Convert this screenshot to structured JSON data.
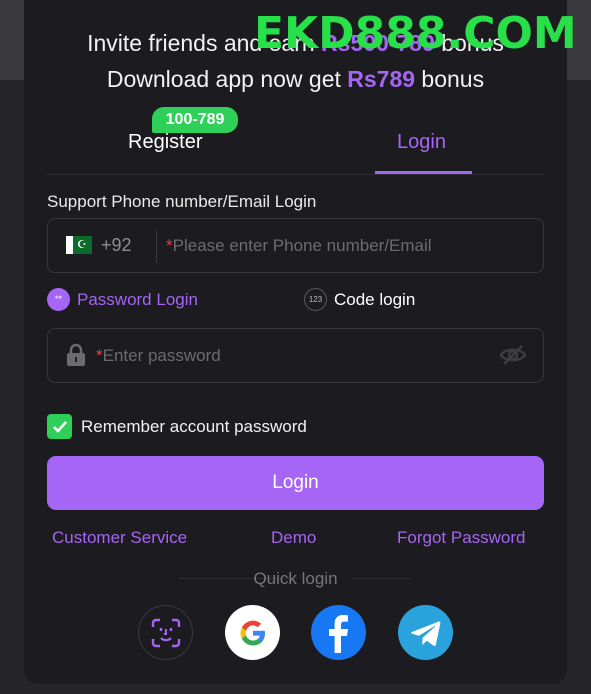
{
  "watermark": "EKD888.COM",
  "promo": {
    "line1_prefix": "Invite friends and earn ",
    "line1_amount": "Rs500-789",
    "line1_suffix": " bonus",
    "line2_prefix": "Download app now get ",
    "line2_amount": "Rs789",
    "line2_suffix": " bonus"
  },
  "tabs": {
    "register_label": "Register",
    "register_badge": "100-789",
    "login_label": "Login"
  },
  "form": {
    "support_label": "Support Phone number/Email Login",
    "country_code": "+92",
    "required_mark": "*",
    "phone_placeholder": "Please enter Phone number/Email",
    "password_mode_label": "Password Login",
    "password_mode_icon_text": "**",
    "code_mode_label": "Code login",
    "code_mode_icon_text": "123",
    "password_placeholder": "Enter password",
    "remember_label": "Remember account password",
    "remember_checked": true,
    "submit_label": "Login"
  },
  "links": {
    "customer_service": "Customer Service",
    "demo": "Demo",
    "forgot_password": "Forgot Password"
  },
  "quick_login": {
    "label": "Quick login",
    "providers": [
      "face-id-icon",
      "google-icon",
      "facebook-icon",
      "telegram-icon"
    ]
  },
  "colors": {
    "accent": "#a565f5",
    "badge_green": "#2fd05a",
    "watermark_green": "#27e04a",
    "background": "#1c1b1f"
  }
}
